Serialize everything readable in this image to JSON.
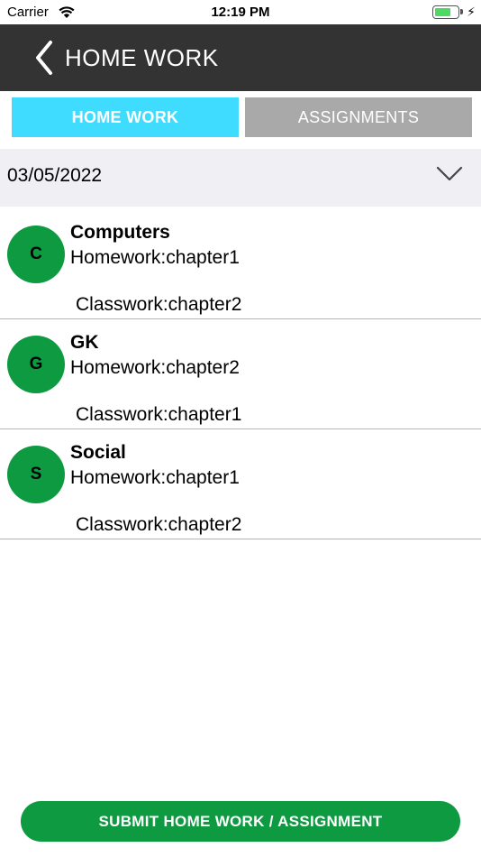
{
  "status_bar": {
    "carrier": "Carrier",
    "time": "12:19 PM",
    "battery_percent": 75,
    "charging_icon": "⚡",
    "icons": [
      "wifi-icon",
      "battery-icon",
      "charging-bolt-icon"
    ]
  },
  "nav": {
    "back_icon": "chevron-left-icon",
    "title": "HOME WORK"
  },
  "tabs": [
    {
      "label": "HOME WORK",
      "active": true,
      "color": "#40dcff"
    },
    {
      "label": "ASSIGNMENTS",
      "active": false,
      "color": "#a9a9a9"
    }
  ],
  "date_selector": {
    "value": "03/05/2022",
    "icon": "chevron-down-icon"
  },
  "items": [
    {
      "initial": "C",
      "subject": "Computers",
      "homework": "Homework:chapter1",
      "classwork": "Classwork:chapter2"
    },
    {
      "initial": "G",
      "subject": "GK",
      "homework": "Homework:chapter2",
      "classwork": "Classwork:chapter1"
    },
    {
      "initial": "S",
      "subject": "Social",
      "homework": "Homework:chapter1",
      "classwork": "Classwork:chapter2"
    }
  ],
  "submit": {
    "label": "SUBMIT HOME WORK / ASSIGNMENT"
  },
  "colors": {
    "nav_background": "#333333",
    "accent_green": "#0e9a41",
    "active_tab": "#40dcff",
    "inactive_tab": "#a9a9a9"
  }
}
